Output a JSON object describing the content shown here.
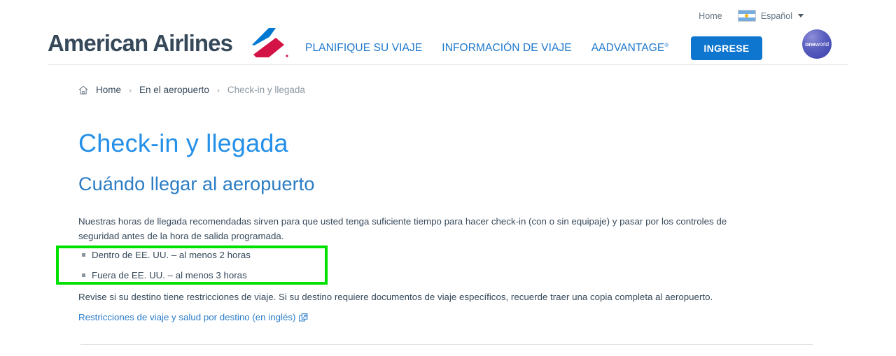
{
  "utility": {
    "home_label": "Home",
    "language_label": "Español",
    "flag_icon": "argentina-flag-icon",
    "caret_icon": "chevron-down-icon"
  },
  "header": {
    "logo_text": "American Airlines",
    "logo_symbol_icon": "american-airlines-flight-symbol",
    "nav": [
      {
        "label": "PLANIFIQUE SU VIAJE"
      },
      {
        "label": "INFORMACIÓN DE VIAJE"
      },
      {
        "label": "AADVANTAGE",
        "superscript": "®"
      }
    ],
    "login_label": "INGRESE",
    "alliance_logo": {
      "prefix": "one",
      "suffix": "world"
    }
  },
  "breadcrumb": {
    "home_icon": "home-icon",
    "separator": "›",
    "items": [
      {
        "label": "Home",
        "current": false
      },
      {
        "label": "En el aeropuerto",
        "current": false
      },
      {
        "label": "Check-in y llegada",
        "current": true
      }
    ]
  },
  "content": {
    "page_title": "Check-in y llegada",
    "section_title": "Cuándo llegar al aeropuerto",
    "intro_paragraph": "Nuestras horas de llegada recomendadas sirven para que usted tenga suficiente tiempo para hacer check-in (con o sin equipaje) y pasar por los controles de seguridad antes de la hora de salida programada.",
    "arrival_times": [
      "Dentro de EE. UU. – al menos 2 horas",
      "Fuera de EE. UU. – al menos 3 horas"
    ],
    "restrictions_paragraph": "Revise si su destino tiene restricciones de viaje. Si su destino requiere documentos de viaje específicos, recuerde traer una copia completa al aeropuerto.",
    "restrictions_link": {
      "label": "Restricciones de viaje y salud por destino (en inglés)",
      "icon": "external-link-icon"
    }
  },
  "annotation": {
    "highlight_color": "#00e100",
    "target": "arrival-times-list"
  },
  "colors": {
    "brand_blue": "#0f76d0",
    "nav_link": "#1d77cc",
    "title_blue": "#2490e8",
    "section_blue": "#2b7cc4",
    "body_text": "#36495a",
    "muted_text": "#8d9aa5"
  }
}
